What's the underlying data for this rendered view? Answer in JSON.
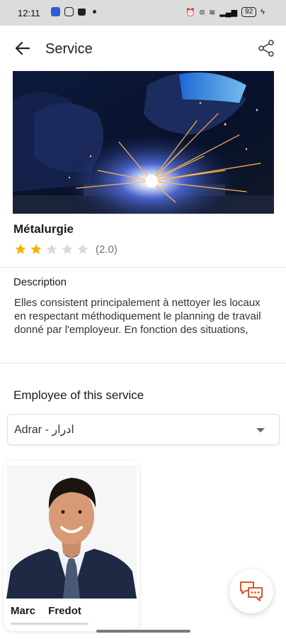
{
  "status_bar": {
    "time": "12:11",
    "battery": "92"
  },
  "app_bar": {
    "title": "Service",
    "back_icon": "arrow-left-icon",
    "share_icon": "share-icon"
  },
  "service": {
    "image": "welding-photo",
    "name": "Métalurgie",
    "rating_value": 2.0,
    "rating_max": 5,
    "rating_text": "(2.0)",
    "star_color": "#F5B400",
    "star_empty_color": "#D9D9D9"
  },
  "description": {
    "title": "Description",
    "text": "Elles consistent principalement à nettoyer les locaux en respectant méthodiquement le planning de travail donné par l'employeur. En fonction des situations,"
  },
  "employees": {
    "title": "Employee of this service",
    "location_select": {
      "value": "Adrar - ادرار"
    },
    "cards": [
      {
        "first_name": "Marc",
        "last_name": "Fredot",
        "name": "Marc Fredot"
      }
    ]
  },
  "chat_button": {
    "icon": "chat-icon",
    "color": "#E0542E"
  }
}
